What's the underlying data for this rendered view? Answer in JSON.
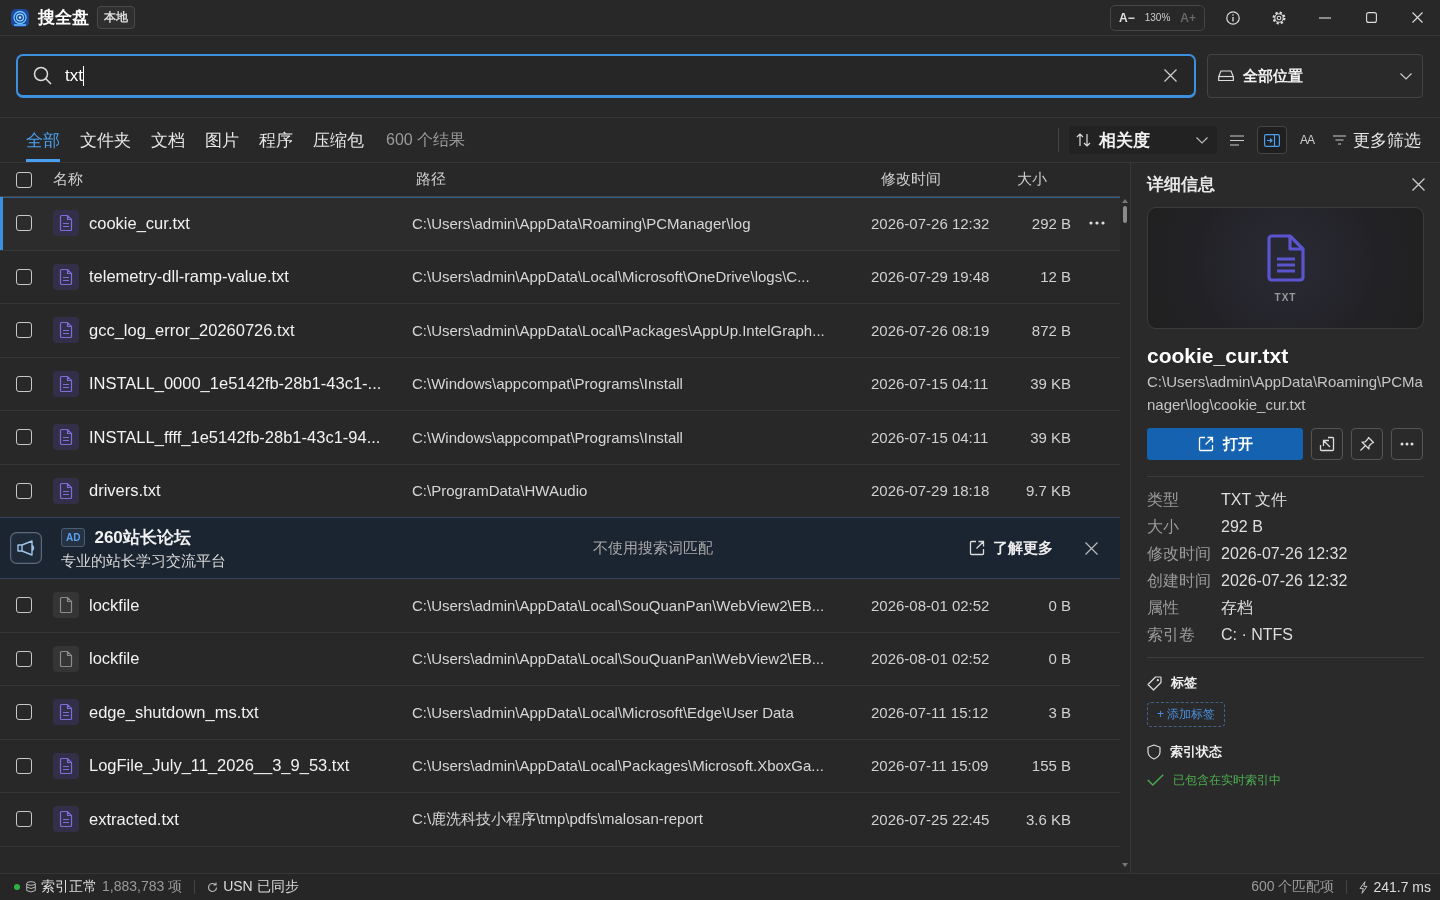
{
  "title_bar": {
    "app_name": "搜全盘",
    "badge": "本地",
    "zoom": {
      "buttons": [
        {
          "label": "A−",
          "disabled": false
        },
        {
          "label": "A+",
          "disabled": true
        }
      ],
      "level": "130%"
    }
  },
  "search": {
    "value": "txt"
  },
  "location": {
    "label": "全部位置"
  },
  "tabs": [
    {
      "label": "全部",
      "selected": true
    },
    {
      "label": "文件夹",
      "selected": false
    },
    {
      "label": "文档",
      "selected": false
    },
    {
      "label": "图片",
      "selected": false
    },
    {
      "label": "程序",
      "selected": false
    },
    {
      "label": "压缩包",
      "selected": false
    }
  ],
  "result_count": "600 个结果",
  "toolbar": {
    "sort": "相关度",
    "view_buttons": [
      {
        "kind": "list",
        "selected": false
      },
      {
        "kind": "details",
        "selected": true
      },
      {
        "kind": "font",
        "label": "AA",
        "selected": false
      }
    ],
    "filter": "更多筛选"
  },
  "table": {
    "all_checked": false,
    "columns": [
      "名称",
      "路径",
      "修改时间",
      "大小"
    ],
    "rows": [
      {
        "kind": "text",
        "name": "cookie_cur.txt",
        "path": "C:\\Users\\admin\\AppData\\Roaming\\PCManager\\log",
        "modified": "2026-07-26 12:32",
        "size": "292 B",
        "checked": false,
        "selected": true
      },
      {
        "kind": "text",
        "name": "telemetry-dll-ramp-value.txt",
        "path": "C:\\Users\\admin\\AppData\\Local\\Microsoft\\OneDrive\\logs\\C...",
        "modified": "2026-07-29 19:48",
        "size": "12 B",
        "checked": false,
        "selected": false
      },
      {
        "kind": "text",
        "name": "gcc_log_error_20260726.txt",
        "path": "C:\\Users\\admin\\AppData\\Local\\Packages\\AppUp.IntelGraph...",
        "modified": "2026-07-26 08:19",
        "size": "872 B",
        "checked": false,
        "selected": false
      },
      {
        "kind": "text",
        "name": "INSTALL_0000_1e5142fb-28b1-43c1-...",
        "path": "C:\\Windows\\appcompat\\Programs\\Install",
        "modified": "2026-07-15 04:11",
        "size": "39 KB",
        "checked": false,
        "selected": false
      },
      {
        "kind": "text",
        "name": "INSTALL_ffff_1e5142fb-28b1-43c1-94...",
        "path": "C:\\Windows\\appcompat\\Programs\\Install",
        "modified": "2026-07-15 04:11",
        "size": "39 KB",
        "checked": false,
        "selected": false
      },
      {
        "kind": "text",
        "name": "drivers.txt",
        "path": "C:\\ProgramData\\HWAudio",
        "modified": "2026-07-29 18:18",
        "size": "9.7 KB",
        "checked": false,
        "selected": false
      },
      {
        "kind": "ad",
        "badge": "AD",
        "title": "260站长论坛",
        "subtitle": "专业的站长学习交流平台",
        "note": "不使用搜索词匹配",
        "link": "了解更多"
      },
      {
        "kind": "file",
        "name": "lockfile",
        "path": "C:\\Users\\admin\\AppData\\Local\\SouQuanPan\\WebView2\\EB...",
        "modified": "2026-08-01 02:52",
        "size": "0 B",
        "checked": false,
        "selected": false
      },
      {
        "kind": "file",
        "name": "lockfile",
        "path": "C:\\Users\\admin\\AppData\\Local\\SouQuanPan\\WebView2\\EB...",
        "modified": "2026-08-01 02:52",
        "size": "0 B",
        "checked": false,
        "selected": false
      },
      {
        "kind": "text",
        "name": "edge_shutdown_ms.txt",
        "path": "C:\\Users\\admin\\AppData\\Local\\Microsoft\\Edge\\User Data",
        "modified": "2026-07-11 15:12",
        "size": "3 B",
        "checked": false,
        "selected": false
      },
      {
        "kind": "text",
        "name": "LogFile_July_11_2026__3_9_53.txt",
        "path": "C:\\Users\\admin\\AppData\\Local\\Packages\\Microsoft.XboxGa...",
        "modified": "2026-07-11 15:09",
        "size": "155 B",
        "checked": false,
        "selected": false
      },
      {
        "kind": "text",
        "name": "extracted.txt",
        "path": "C:\\鹿洗科技小程序\\tmp\\pdfs\\malosan-report",
        "modified": "2026-07-25 22:45",
        "size": "3.6 KB",
        "checked": false,
        "selected": false
      }
    ]
  },
  "details": {
    "title": "详细信息",
    "preview_label": "TXT",
    "name": "cookie_cur.txt",
    "path": "C:\\Users\\admin\\AppData\\Roaming\\PCManager\\log\\cookie_cur.txt",
    "open_button": "打开",
    "properties": [
      {
        "label": "类型",
        "value": "TXT 文件"
      },
      {
        "label": "大小",
        "value": "292 B"
      },
      {
        "label": "修改时间",
        "value": "2026-07-26 12:32"
      },
      {
        "label": "创建时间",
        "value": "2026-07-26 12:32"
      },
      {
        "label": "属性",
        "value": "存档"
      },
      {
        "label": "索引卷",
        "value": "C: · NTFS"
      }
    ],
    "tags_title": "标签",
    "add_tag": "+ 添加标签",
    "index_title": "索引状态",
    "index_status": "已包含在实时索引中"
  },
  "status_bar": {
    "index_ok": true,
    "index_label": "索引正常",
    "index_count": "1,883,783 项",
    "usn": "USN 已同步",
    "matches": "600 个匹配项",
    "elapsed": "241.7 ms"
  }
}
